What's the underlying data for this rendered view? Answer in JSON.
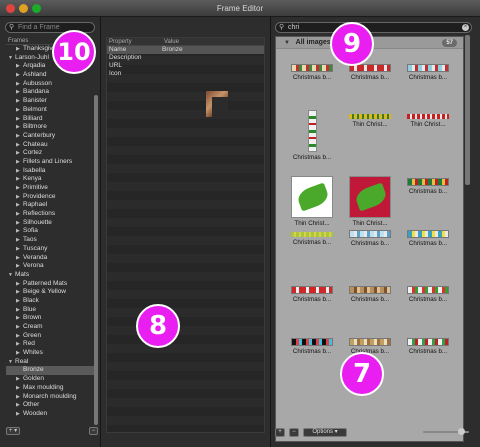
{
  "window": {
    "title": "Frame Editor"
  },
  "left": {
    "search_placeholder": "Find a Frame",
    "tree_header": "Frames",
    "rows": [
      {
        "indent": 1,
        "tri": "▶",
        "label": "Thanksgiving"
      },
      {
        "indent": 0,
        "tri": "▼",
        "label": "Larson-Juhl"
      },
      {
        "indent": 1,
        "tri": "▶",
        "label": "Arqadia"
      },
      {
        "indent": 1,
        "tri": "▶",
        "label": "Ashland"
      },
      {
        "indent": 1,
        "tri": "▶",
        "label": "Aubusson"
      },
      {
        "indent": 1,
        "tri": "▶",
        "label": "Bandana"
      },
      {
        "indent": 1,
        "tri": "▶",
        "label": "Banister"
      },
      {
        "indent": 1,
        "tri": "▶",
        "label": "Belmont"
      },
      {
        "indent": 1,
        "tri": "▶",
        "label": "Billiard"
      },
      {
        "indent": 1,
        "tri": "▶",
        "label": "Biltmore"
      },
      {
        "indent": 1,
        "tri": "▶",
        "label": "Canterbury"
      },
      {
        "indent": 1,
        "tri": "▶",
        "label": "Chateau"
      },
      {
        "indent": 1,
        "tri": "▶",
        "label": "Cortez"
      },
      {
        "indent": 1,
        "tri": "▶",
        "label": "Fillets and Liners"
      },
      {
        "indent": 1,
        "tri": "▶",
        "label": "Isabella"
      },
      {
        "indent": 1,
        "tri": "▶",
        "label": "Kenya"
      },
      {
        "indent": 1,
        "tri": "▶",
        "label": "Primitive"
      },
      {
        "indent": 1,
        "tri": "▶",
        "label": "Providence"
      },
      {
        "indent": 1,
        "tri": "▶",
        "label": "Raphael"
      },
      {
        "indent": 1,
        "tri": "▶",
        "label": "Reflections"
      },
      {
        "indent": 1,
        "tri": "▶",
        "label": "Silhouette"
      },
      {
        "indent": 1,
        "tri": "▶",
        "label": "Sofia"
      },
      {
        "indent": 1,
        "tri": "▶",
        "label": "Taos"
      },
      {
        "indent": 1,
        "tri": "▶",
        "label": "Tuscany"
      },
      {
        "indent": 1,
        "tri": "▶",
        "label": "Veranda"
      },
      {
        "indent": 1,
        "tri": "▶",
        "label": "Verona"
      },
      {
        "indent": 0,
        "tri": "▼",
        "label": "Mats"
      },
      {
        "indent": 1,
        "tri": "▶",
        "label": "Patterned Mats"
      },
      {
        "indent": 1,
        "tri": "▶",
        "label": "Beige & Yellow"
      },
      {
        "indent": 1,
        "tri": "▶",
        "label": "Black"
      },
      {
        "indent": 1,
        "tri": "▶",
        "label": "Blue"
      },
      {
        "indent": 1,
        "tri": "▶",
        "label": "Brown"
      },
      {
        "indent": 1,
        "tri": "▶",
        "label": "Cream"
      },
      {
        "indent": 1,
        "tri": "▶",
        "label": "Green"
      },
      {
        "indent": 1,
        "tri": "▶",
        "label": "Red"
      },
      {
        "indent": 1,
        "tri": "▶",
        "label": "Whites"
      },
      {
        "indent": 0,
        "tri": "▼",
        "label": "Real"
      },
      {
        "indent": 1,
        "tri": "",
        "label": "Bronze",
        "selected": true
      },
      {
        "indent": 1,
        "tri": "▶",
        "label": "Golden"
      },
      {
        "indent": 1,
        "tri": "▶",
        "label": "Max moulding"
      },
      {
        "indent": 1,
        "tri": "▶",
        "label": "Monarch moulding"
      },
      {
        "indent": 1,
        "tri": "▶",
        "label": "Other"
      },
      {
        "indent": 1,
        "tri": "▶",
        "label": "Wooden"
      }
    ],
    "add_menu_label": "+ ▾",
    "remove_label": "−"
  },
  "middle": {
    "col_property": "Property",
    "col_value": "Value",
    "rows": [
      {
        "property": "Name",
        "value": "Bronze"
      },
      {
        "property": "Description",
        "value": ""
      },
      {
        "property": "URL",
        "value": ""
      },
      {
        "property": "Icon",
        "value": ""
      }
    ]
  },
  "right": {
    "search_value": "chri",
    "group_title": "All images",
    "count": "57",
    "add_label": "+",
    "remove_label": "−",
    "options_label": "Options ▾",
    "images": [
      {
        "label": "Christmas b...",
        "kind": "strip",
        "colors": [
          "#e8d9b0",
          "#c03030",
          "#3a8a3a"
        ]
      },
      {
        "label": "Christmas b...",
        "kind": "strip",
        "colors": [
          "#c82828",
          "#e8e8e8",
          "#c82828"
        ]
      },
      {
        "label": "Christmas b...",
        "kind": "strip",
        "colors": [
          "#8fd0e0",
          "#e8e8e8",
          "#c03030"
        ]
      },
      {
        "label": "Christmas b...",
        "kind": "vertical",
        "colors": [
          "#f0f0f0",
          "#2a8a2a",
          "#c02020"
        ]
      },
      {
        "label": "Thin Christ...",
        "kind": "thin",
        "colors": [
          "#d8b820",
          "#3a7a2a"
        ]
      },
      {
        "label": "Thin Christ...",
        "kind": "thin",
        "colors": [
          "#c82020",
          "#e8e8e8"
        ]
      },
      {
        "label": "Thin Christ...",
        "kind": "holly-white",
        "colors": [
          "#ffffff",
          "#4aa82a"
        ]
      },
      {
        "label": "Thin Christ...",
        "kind": "holly-red",
        "colors": [
          "#c01838",
          "#4aa82a"
        ]
      },
      {
        "label": "Christmas b...",
        "kind": "strip",
        "colors": [
          "#1e7a3a",
          "#e0c040",
          "#c02020"
        ]
      },
      {
        "label": "Christmas b...",
        "kind": "thin",
        "colors": [
          "#a8c838",
          "#d8d050"
        ]
      },
      {
        "label": "Christmas b...",
        "kind": "strip",
        "colors": [
          "#bfe0f0",
          "#e8e8e8",
          "#5aa0c8"
        ]
      },
      {
        "label": "Christmas b...",
        "kind": "strip",
        "colors": [
          "#3aa0c0",
          "#f0e040",
          "#e8e8e8"
        ]
      },
      {
        "label": "Christmas b...",
        "kind": "strip",
        "colors": [
          "#d02828",
          "#f0f0f0",
          "#d02828"
        ]
      },
      {
        "label": "Christmas b...",
        "kind": "strip",
        "colors": [
          "#b89060",
          "#7a5030",
          "#e0c090"
        ]
      },
      {
        "label": "Christmas b...",
        "kind": "strip",
        "colors": [
          "#f0f0f0",
          "#e03030",
          "#30a030"
        ]
      },
      {
        "label": "Christmas b...",
        "kind": "strip",
        "colors": [
          "#101010",
          "#e04040",
          "#40c0e0"
        ]
      },
      {
        "label": "Christmas b...",
        "kind": "strip",
        "colors": [
          "#c0a060",
          "#e8e0c0",
          "#a07040"
        ]
      },
      {
        "label": "Christmas b...",
        "kind": "strip",
        "colors": [
          "#f0f0f0",
          "#30a050",
          "#c02020"
        ]
      }
    ]
  },
  "markers": [
    {
      "name": "marker-10",
      "label": "10"
    },
    {
      "name": "marker-9",
      "label": "9"
    },
    {
      "name": "marker-8",
      "label": "8"
    },
    {
      "name": "marker-7",
      "label": "7"
    }
  ]
}
